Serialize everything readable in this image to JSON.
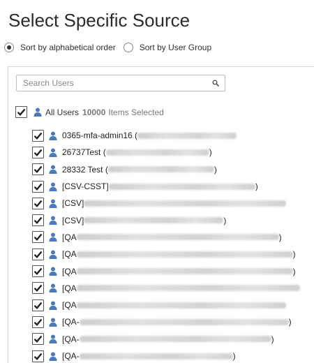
{
  "title": "Select Specific Source",
  "sort": {
    "options": [
      {
        "label": "Sort by alphabetical order",
        "checked": true
      },
      {
        "label": "Sort by User Group",
        "checked": false
      }
    ]
  },
  "search": {
    "placeholder": "Search Users"
  },
  "all_users": {
    "label": "All Users",
    "count": "10000",
    "suffix": "Items Selected"
  },
  "users": [
    {
      "name": "0365-mfa-admin16 (",
      "close": ""
    },
    {
      "name": "26737Test (",
      "close": ")"
    },
    {
      "name": "28332 Test (",
      "close": ")"
    },
    {
      "name": "[CSV-CSST]",
      "close": ")"
    },
    {
      "name": "[CSV]",
      "close": ""
    },
    {
      "name": "[CSV]",
      "close": ")"
    },
    {
      "name": "[QA",
      "close": ")"
    },
    {
      "name": "[QA",
      "close": ")"
    },
    {
      "name": "[QA",
      "close": ")"
    },
    {
      "name": "[QA",
      "close": ""
    },
    {
      "name": "[QA",
      "close": ""
    },
    {
      "name": "[QA-",
      "close": ")"
    },
    {
      "name": "[QA-",
      "close": ")"
    },
    {
      "name": "[QA-",
      "close": ")"
    }
  ],
  "colors": {
    "user_icon": "#4a7ab8",
    "check": "#222222"
  },
  "icons": {
    "search": "search-icon",
    "user": "user-icon",
    "check": "check-icon"
  }
}
